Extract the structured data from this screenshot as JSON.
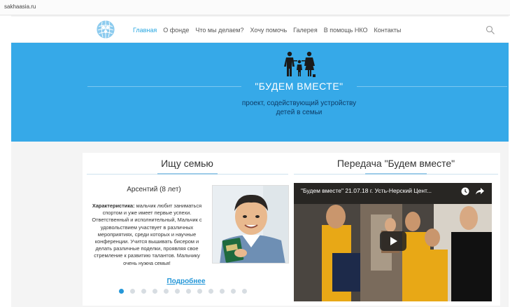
{
  "browser": {
    "url": "sakhaasia.ru"
  },
  "nav": {
    "items": [
      {
        "label": "Главная",
        "active": true
      },
      {
        "label": "О фонде",
        "active": false
      },
      {
        "label": "Что мы делаем?",
        "active": false
      },
      {
        "label": "Хочу помочь",
        "active": false
      },
      {
        "label": "Галерея",
        "active": false
      },
      {
        "label": "В помощь НКО",
        "active": false
      },
      {
        "label": "Контакты",
        "active": false
      }
    ]
  },
  "hero": {
    "title": "\"БУДЕМ ВМЕСТЕ\"",
    "subtitle_line1": "проект, содействующий устройству",
    "subtitle_line2": "детей в семьи"
  },
  "family_section": {
    "heading": "Ищу семью",
    "child_name": "Арсентий (8 лет)",
    "desc_label": "Характеристика:",
    "desc_text": "мальчик любит заниматься спортом и уже имеет первые успехи. Ответственный и исполнительный, Мальчик с удовольствием участвует в различных мероприятиях, среди которых и научные конференции. Учится вышивать бисером и делать различные поделки, проявляя свое стремление к развитию талантов. Мальчику очень нужна семья!",
    "more_link": "Подробнее",
    "slide_count": 12,
    "active_slide": 0
  },
  "video_section": {
    "heading": "Передача \"Будем вместе\"",
    "video_title": "\"Будем вместе\" 21.07.18 г. Усть-Нерский Цент..."
  },
  "colors": {
    "accent": "#36a9e8",
    "link": "#2597d8",
    "nav_active": "#29a7e1",
    "hero_text_dark": "#0d3b66"
  }
}
